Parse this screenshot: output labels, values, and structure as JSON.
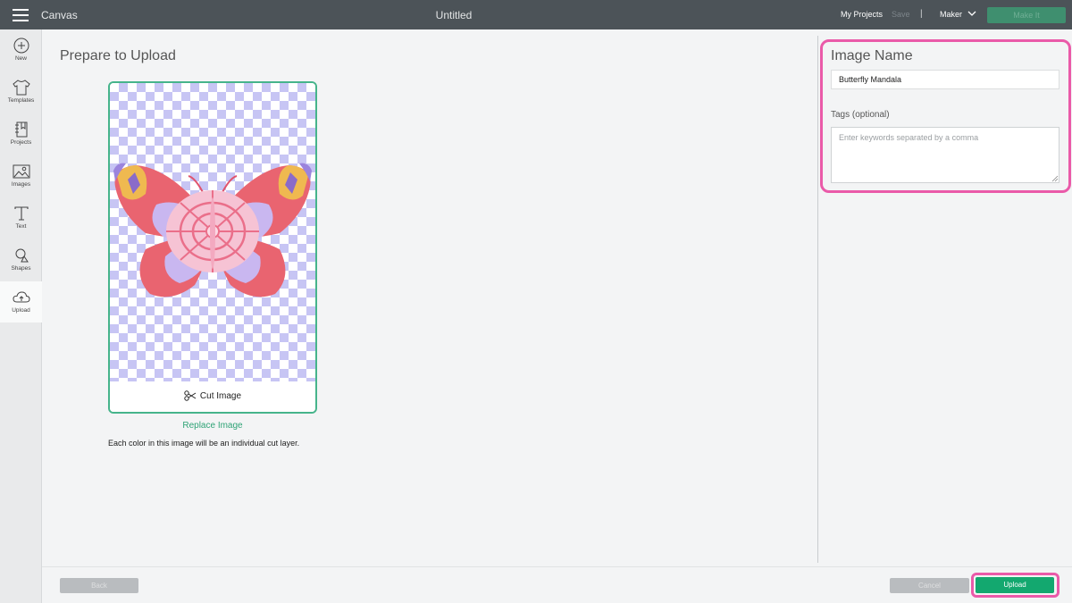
{
  "topbar": {
    "app_title": "Canvas",
    "document_title": "Untitled",
    "my_projects": "My Projects",
    "save": "Save",
    "separator": "|",
    "machine": "Maker",
    "make_it": "Make It"
  },
  "sidebar": {
    "items": [
      {
        "label": "New",
        "icon": "plus-circle-icon"
      },
      {
        "label": "Templates",
        "icon": "tshirt-icon"
      },
      {
        "label": "Projects",
        "icon": "notebook-icon"
      },
      {
        "label": "Images",
        "icon": "image-icon"
      },
      {
        "label": "Text",
        "icon": "text-t-icon"
      },
      {
        "label": "Shapes",
        "icon": "shapes-icon"
      },
      {
        "label": "Upload",
        "icon": "cloud-upload-icon",
        "active": true
      }
    ]
  },
  "main": {
    "title": "Prepare to Upload",
    "cut_image": "Cut Image",
    "replace_image": "Replace Image",
    "info_text": "Each color in this image will be an individual cut layer."
  },
  "panel": {
    "image_name_label": "Image Name",
    "image_name_value": "Butterfly Mandala",
    "tags_label": "Tags (optional)",
    "tags_placeholder": "Enter keywords separated by a comma"
  },
  "footer": {
    "back": "Back",
    "cancel": "Cancel",
    "upload": "Upload"
  },
  "colors": {
    "accent_green": "#13a86f",
    "highlight_pink": "#ea5aa9",
    "topbar": "#4c5358",
    "checker_lavender": "#c7c5f4"
  }
}
